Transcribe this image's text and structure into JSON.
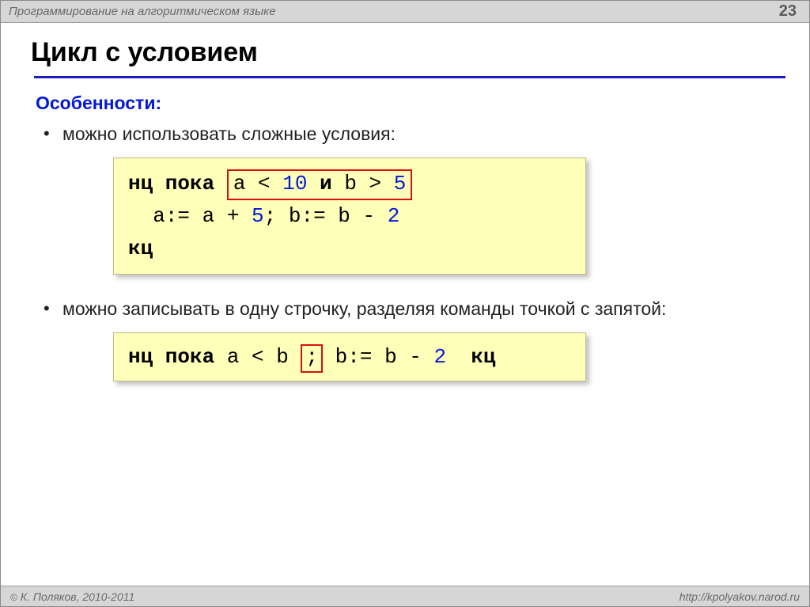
{
  "header": {
    "title": "Программирование на алгоритмическом языке",
    "page_number": "23"
  },
  "title": "Цикл с условием",
  "section_label": "Особенности:",
  "bullets": [
    "можно использовать сложные условия:",
    "можно записывать в одну строчку, разделяя команды точкой с запятой:"
  ],
  "code1": {
    "kw_nts_poka": "нц пока",
    "cond_a": "a",
    "cond_lt": "<",
    "cond_10": "10",
    "cond_and": "и",
    "cond_b": "b",
    "cond_gt": ">",
    "cond_5": "5",
    "body_a_assign": "a:= a +",
    "body_5": "5",
    "body_sep": ";",
    "body_b_assign": "b:= b -",
    "body_2": "2",
    "kw_kts": "кц"
  },
  "code2": {
    "kw_nts_poka": "нц пока",
    "cond": "a < b",
    "semi": ";",
    "body_b_assign": "b:= b -",
    "body_2": "2",
    "kw_kts": "кц"
  },
  "footer": {
    "copyright_symbol": "©",
    "author": "К. Поляков, 2010-2011",
    "url": "http://kpolyakov.narod.ru"
  }
}
